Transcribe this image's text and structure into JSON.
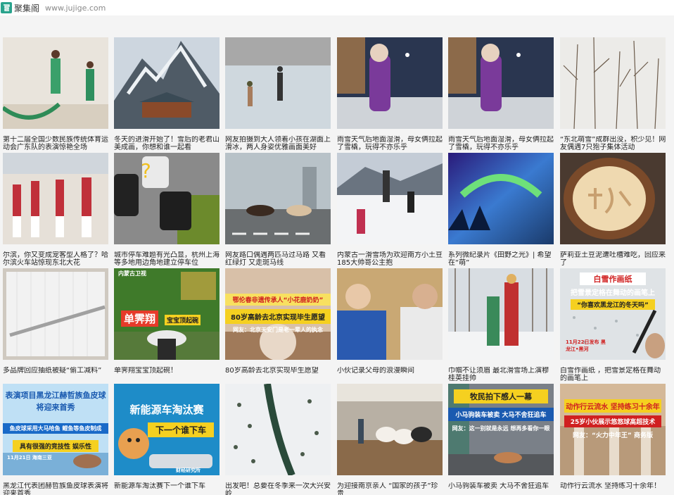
{
  "site": {
    "name": "聚集阁",
    "url": "www.jujige.com"
  },
  "cards": [
    {
      "caption": "第十二届全国少数民族传统体育运动会广东队的表演惊艳全场",
      "overlay": []
    },
    {
      "caption": "冬天的进滑开始了！雪后的老君山美成画，你想和谁一起看",
      "overlay": []
    },
    {
      "caption": "网友拍摄到大人领着小孩在湖面上滑冰，两人身姿优雅画面美好",
      "overlay": []
    },
    {
      "caption": "雨雪天气后地面湿滑，母女俩拉起了雪橇，玩得不亦乐乎",
      "overlay": []
    },
    {
      "caption": "雨雪天气后地面湿滑，母女俩拉起了雪橇，玩得不亦乐乎",
      "overlay": []
    },
    {
      "caption": "“东北萌雪”成群出没，积少见！网友偶遇7只狍子集体活动",
      "overlay": []
    },
    {
      "caption": "尔滨，你又变成宠客型人格了？哈尔滨火车站惊现东北大花",
      "overlay": []
    },
    {
      "caption": "城市停车难题有光凸显，杭州上海等多地用边角地建立停车位",
      "overlay": []
    },
    {
      "caption": "网友路口偶遇两匹马过马路 又看红绿灯 又走斑马线",
      "overlay": []
    },
    {
      "caption": "内蒙古一滑雪场为欢迎南方小土豆 185大帅哥公主抱",
      "overlay": []
    },
    {
      "caption": "系列微纪录片《田野之光》| 希望在“萌”",
      "overlay": []
    },
    {
      "caption": "萨莉亚土豆泥遭吐槽难吃，回应来了",
      "overlay": []
    },
    {
      "caption": "多品牌回应抽纸被疑“偷工减料”",
      "overlay": []
    },
    {
      "caption": "单霁翔宝宝顶起碗！",
      "overlay": [
        "内蒙古卫视",
        "单霁翔",
        "宝宝顶起碗"
      ]
    },
    {
      "caption": "80岁高龄去北京实现毕生愿望",
      "overlay": [
        "鄂伦春非遗传承人“小花鹿奶奶”",
        "80岁高龄去北京实现毕生愿望",
        "网友：北京天安门是老一辈人的执念"
      ]
    },
    {
      "caption": "小伙记录父母的浪漫瞬间",
      "overlay": []
    },
    {
      "caption": "巾帼不让须眉 最北滑雪场上演穆桂英挂帅",
      "overlay": []
    },
    {
      "caption": "白雪作画纸 ，把雪景定格在舞动的画笔上",
      "overlay": [
        "白雪作画纸",
        "把雪景定格在舞动的画笔上",
        "“你喜欢黑龙江的冬天吗”",
        "11月22日发布 黑龙江•黑河"
      ]
    },
    {
      "caption": "黑龙江代表团赫哲族鱼皮球表演将迎来首秀",
      "overlay": [
        "表演项目黑龙江赫哲族鱼皮球",
        "将迎来首秀",
        "鱼皮球采用大马哈鱼 鲤鱼等鱼皮制成",
        "具有很强的竞技性 娱乐性",
        "11月21日 海南三亚"
      ]
    },
    {
      "caption": "新能源车淘汰赛下一个谁下车",
      "overlay": [
        "新能源车淘汰赛",
        "下一个谁下车",
        "财经研究所"
      ]
    },
    {
      "caption": "出发吧！总要在冬季来一次大兴安岭",
      "overlay": []
    },
    {
      "caption": "为迎接南京亲人 “国家的孩子”珍贵",
      "overlay": []
    },
    {
      "caption": "小马驹装车被卖 大马不舍狂追车",
      "overlay": [
        "牧民拍下感人一幕",
        "小马驹装车被卖 大马不舍狂追车",
        "网友：这一别就是永远 想再多看你一眼"
      ]
    },
    {
      "caption": "动作行云流水 坚持练习十余年！",
      "overlay": [
        "动作行云流水 坚持练习十余年",
        "25岁小伙展示悠悠球高超技术",
        "网友：“火力中年王” 商务版"
      ]
    }
  ]
}
